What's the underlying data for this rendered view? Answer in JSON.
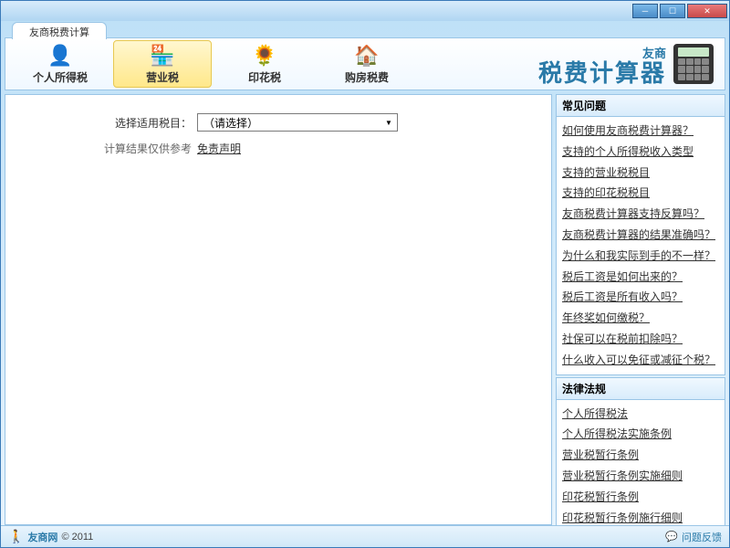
{
  "window": {
    "title": "友商税费计算"
  },
  "tabs": {
    "items": [
      {
        "label": "个人所得税"
      },
      {
        "label": "营业税"
      },
      {
        "label": "印花税"
      },
      {
        "label": "购房税费"
      }
    ]
  },
  "brand": {
    "sub": "友商",
    "main": "税费计算器"
  },
  "form": {
    "select_label": "选择适用税目：",
    "select_value": "（请选择）",
    "note_label": "计算结果仅供参考",
    "disclaimer": "免责声明"
  },
  "faq": {
    "header": "常见问题",
    "items": [
      "如何使用友商税费计算器？",
      "支持的个人所得税收入类型",
      "支持的营业税税目",
      "支持的印花税税目",
      "友商税费计算器支持反算吗？",
      "友商税费计算器的结果准确吗？",
      "为什么和我实际到手的不一样？",
      "税后工资是如何出来的？",
      "税后工资是所有收入吗？",
      "年终奖如何缴税？",
      "社保可以在税前扣除吗？",
      "什么收入可以免征或减征个税？"
    ]
  },
  "law": {
    "header": "法律法规",
    "items": [
      "个人所得税法",
      "个人所得税法实施条例",
      "营业税暂行条例",
      "营业税暂行条例实施细则",
      "印花税暂行条例",
      "印花税暂行条例施行细则"
    ]
  },
  "status": {
    "site": "友商网",
    "copyright": "© 2011",
    "feedback": "问题反馈"
  }
}
